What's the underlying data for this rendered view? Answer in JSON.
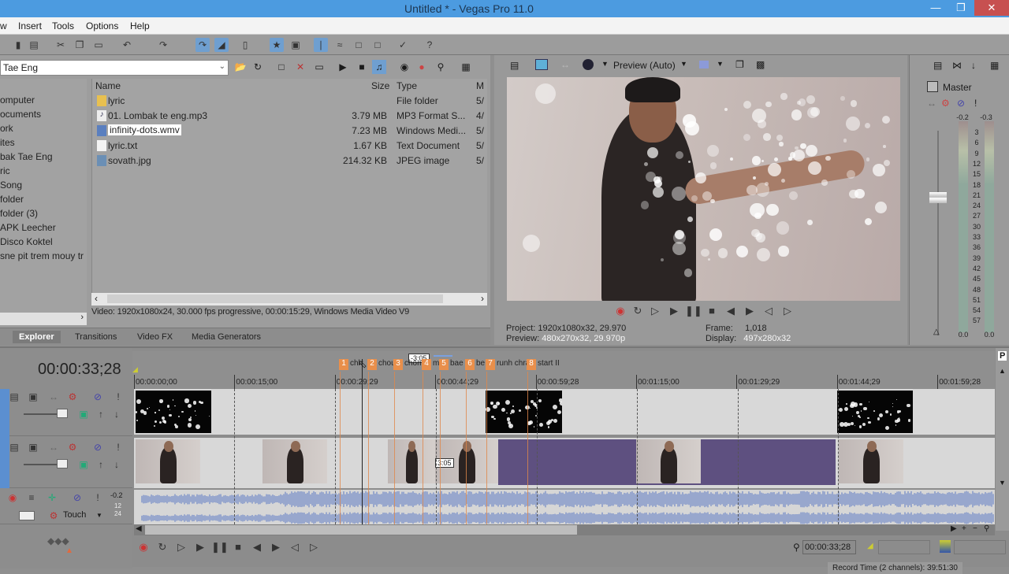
{
  "window": {
    "title": "Untitled * - Vegas Pro 11.0",
    "controls": [
      "minimize-icon",
      "restore-icon",
      "close-icon"
    ]
  },
  "menu": [
    "w",
    "Insert",
    "Tools",
    "Options",
    "Help"
  ],
  "explorer": {
    "address": "Tae Eng",
    "tree": [
      "omputer",
      "ocuments",
      "ork",
      "ites",
      "bak Tae Eng",
      "ric",
      "Song",
      "folder",
      "folder (3)",
      "APK Leecher",
      "Disco Koktel",
      "sne pit trem mouy tr"
    ],
    "columns": {
      "name": "Name",
      "size": "Size",
      "type": "Type",
      "modified": "M"
    },
    "files": [
      {
        "name": "lyric",
        "size": "",
        "type": "File folder",
        "modified": "5/",
        "icon": "folder-icon"
      },
      {
        "name": "01. Lombak te eng.mp3",
        "size": "3.79 MB",
        "type": "MP3 Format S...",
        "modified": "4/",
        "icon": "audio-file-icon"
      },
      {
        "name": "infinity-dots.wmv",
        "size": "7.23 MB",
        "type": "Windows Medi...",
        "modified": "5/",
        "icon": "video-file-icon",
        "selected": true
      },
      {
        "name": "lyric.txt",
        "size": "1.67 KB",
        "type": "Text Document",
        "modified": "5/",
        "icon": "text-file-icon"
      },
      {
        "name": "sovath.jpg",
        "size": "214.32 KB",
        "type": "JPEG image",
        "modified": "5/",
        "icon": "image-file-icon"
      }
    ],
    "info": "Video: 1920x1080x24, 30.000 fps progressive, 00:00:15:29, Windows Media Video V9",
    "tabs": [
      "Explorer",
      "Transitions",
      "Video FX",
      "Media Generators"
    ],
    "active_tab": "Explorer"
  },
  "preview": {
    "mode": "Preview (Auto)",
    "project_label": "Project:",
    "project": "1920x1080x32, 29.970",
    "preview_label": "Preview:",
    "preview": "480x270x32, 29.970p",
    "frame_label": "Frame:",
    "frame": "1,018",
    "display_label": "Display:",
    "display": "497x280x32"
  },
  "mixer": {
    "name": "Master",
    "peak_left": "-0.2",
    "peak_right": "-0.3",
    "scale": [
      "3",
      "6",
      "9",
      "12",
      "15",
      "18",
      "21",
      "24",
      "27",
      "30",
      "33",
      "36",
      "39",
      "42",
      "45",
      "48",
      "51",
      "54",
      "57"
    ],
    "bottom_left": "0.0",
    "bottom_right": "0.0"
  },
  "timeline": {
    "timecode": "00:00:33;28",
    "region_label": "-3:05",
    "ruler": [
      "00:00:00;00",
      "00:00:15;00",
      "00:00:29;29",
      "00:00:44;29",
      "00:00:59;28",
      "00:01:15;00",
      "00:01:29;29",
      "00:01:44;29",
      "00:01:59;28"
    ],
    "markers": [
      {
        "num": "1",
        "label": "chh"
      },
      {
        "num": "2",
        "label": "chou"
      },
      {
        "num": "3",
        "label": "chom"
      },
      {
        "num": "4",
        "label": "m"
      },
      {
        "num": "5",
        "label": "bae"
      },
      {
        "num": "6",
        "label": "be"
      },
      {
        "num": "7",
        "label": "runh chra"
      },
      {
        "num": "8",
        "label": "start II"
      }
    ],
    "transition_label": "3:05",
    "audio_track": {
      "volume": "-0.2",
      "levels": [
        "12",
        "24"
      ],
      "automation": "Touch"
    },
    "track_level_label": "%",
    "end_time": "00:00:33;28",
    "status": "Record Time (2 channels): 39:51:30"
  },
  "colors": {
    "titlebar": "#4c9be0",
    "marker": "#e98f4b",
    "waveform": "#5a78c4",
    "purple_region": "#5e5080"
  }
}
